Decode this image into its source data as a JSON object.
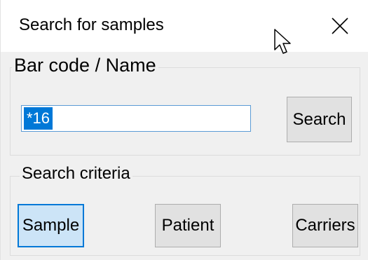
{
  "window": {
    "title": "Search for samples"
  },
  "barcode_group": {
    "legend": "Bar code / Name",
    "search_value": "*16",
    "search_button_label": "Search"
  },
  "criteria_group": {
    "legend": "Search criteria",
    "options": [
      {
        "label": "Sample",
        "selected": true
      },
      {
        "label": "Patient",
        "selected": false
      },
      {
        "label": "Carriers",
        "selected": false
      }
    ]
  },
  "icons": {
    "close": "close-icon",
    "cursor": "mouse-pointer-icon"
  },
  "colors": {
    "selection_highlight": "#0078d7",
    "selected_button_fill": "#cce4f7",
    "button_fill": "#e1e1e1",
    "window_background": "#f0f0f0"
  }
}
